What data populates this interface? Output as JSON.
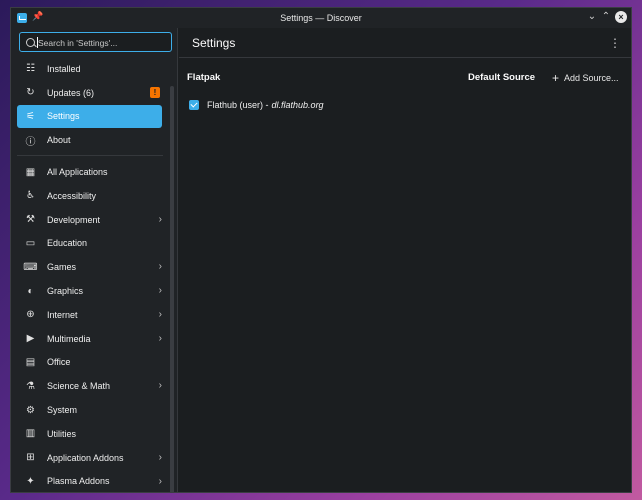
{
  "window": {
    "title": "Settings — Discover"
  },
  "search": {
    "placeholder": "Search in 'Settings'..."
  },
  "header": {
    "title": "Settings"
  },
  "sidebar": {
    "top_items": [
      {
        "label": "Installed",
        "icon": "installed-icon"
      },
      {
        "label": "Updates (6)",
        "icon": "updates-icon",
        "badge": "!"
      },
      {
        "label": "Settings",
        "icon": "settings-icon",
        "active": true
      },
      {
        "label": "About",
        "icon": "about-icon"
      }
    ],
    "categories": [
      {
        "label": "All Applications",
        "icon": "grid-icon",
        "chevron": false
      },
      {
        "label": "Accessibility",
        "icon": "accessibility-icon",
        "chevron": false
      },
      {
        "label": "Development",
        "icon": "development-icon",
        "chevron": true
      },
      {
        "label": "Education",
        "icon": "education-icon",
        "chevron": false
      },
      {
        "label": "Games",
        "icon": "gamepad-icon",
        "chevron": true
      },
      {
        "label": "Graphics",
        "icon": "graphics-icon",
        "chevron": true
      },
      {
        "label": "Internet",
        "icon": "globe-icon",
        "chevron": true
      },
      {
        "label": "Multimedia",
        "icon": "multimedia-icon",
        "chevron": true
      },
      {
        "label": "Office",
        "icon": "office-icon",
        "chevron": false
      },
      {
        "label": "Science & Math",
        "icon": "science-icon",
        "chevron": true
      },
      {
        "label": "System",
        "icon": "system-gear-icon",
        "chevron": false
      },
      {
        "label": "Utilities",
        "icon": "utilities-icon",
        "chevron": false
      },
      {
        "label": "Application Addons",
        "icon": "addons-icon",
        "chevron": true
      },
      {
        "label": "Plasma Addons",
        "icon": "plasma-icon",
        "chevron": true
      }
    ]
  },
  "main": {
    "section": "Flatpak",
    "default_source": "Default Source",
    "add_source": "Add Source...",
    "source": {
      "name": "Flathub (user) -",
      "url": "dl.flathub.org",
      "checked": true
    }
  },
  "colors": {
    "accent": "#3daee9",
    "badge": "#f67400",
    "background": "#1b1e20"
  }
}
